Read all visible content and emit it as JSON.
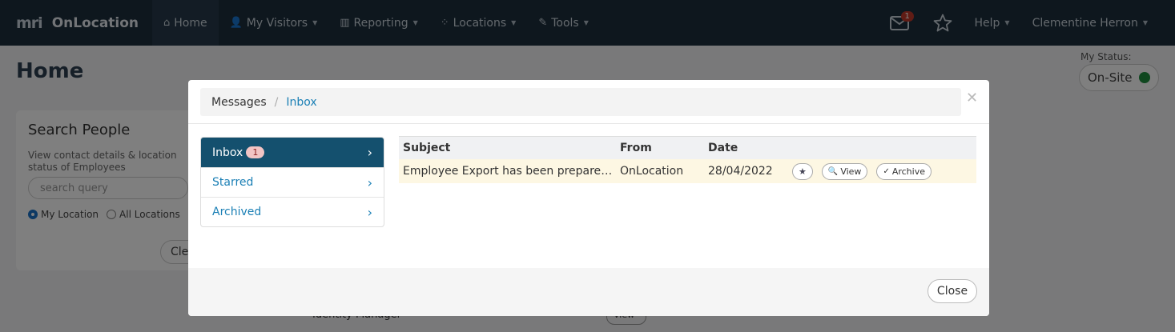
{
  "nav": {
    "brand_logo": "mri",
    "brand_name": "OnLocation",
    "items": [
      {
        "label": "Home",
        "icon": "home-icon"
      },
      {
        "label": "My Visitors",
        "icon": "user-icon"
      },
      {
        "label": "Reporting",
        "icon": "chart-icon"
      },
      {
        "label": "Locations",
        "icon": "locations-icon"
      },
      {
        "label": "Tools",
        "icon": "wrench-icon"
      }
    ],
    "message_count": "1",
    "help_label": "Help",
    "user_name": "Clementine Herron"
  },
  "page": {
    "title": "Home",
    "status_label": "My Status:",
    "status_value": "On-Site",
    "search": {
      "heading": "Search People",
      "hint": "View contact details & location status of Employees",
      "placeholder": "search query",
      "radio_my": "My Location",
      "radio_all": "All Locations",
      "clear_label": "Clear"
    },
    "bg_row_label": "Identity Manager",
    "bg_row_button": "View"
  },
  "modal": {
    "breadcrumb_root": "Messages",
    "breadcrumb_current": "Inbox",
    "folders": [
      {
        "label": "Inbox",
        "badge": "1"
      },
      {
        "label": "Starred"
      },
      {
        "label": "Archived"
      }
    ],
    "table": {
      "headers": {
        "subject": "Subject",
        "from": "From",
        "date": "Date"
      },
      "rows": [
        {
          "subject": "Employee Export has been prepared for download",
          "from": "OnLocation",
          "date": "28/04/2022"
        }
      ],
      "actions": {
        "view": "View",
        "archive": "Archive"
      }
    },
    "close_label": "Close"
  },
  "colors": {
    "nav_bg": "#1c2e3d",
    "active_folder": "#14506e",
    "link": "#1a7fb5",
    "highlight_row": "#fdf7e3",
    "badge": "#c0392b"
  }
}
